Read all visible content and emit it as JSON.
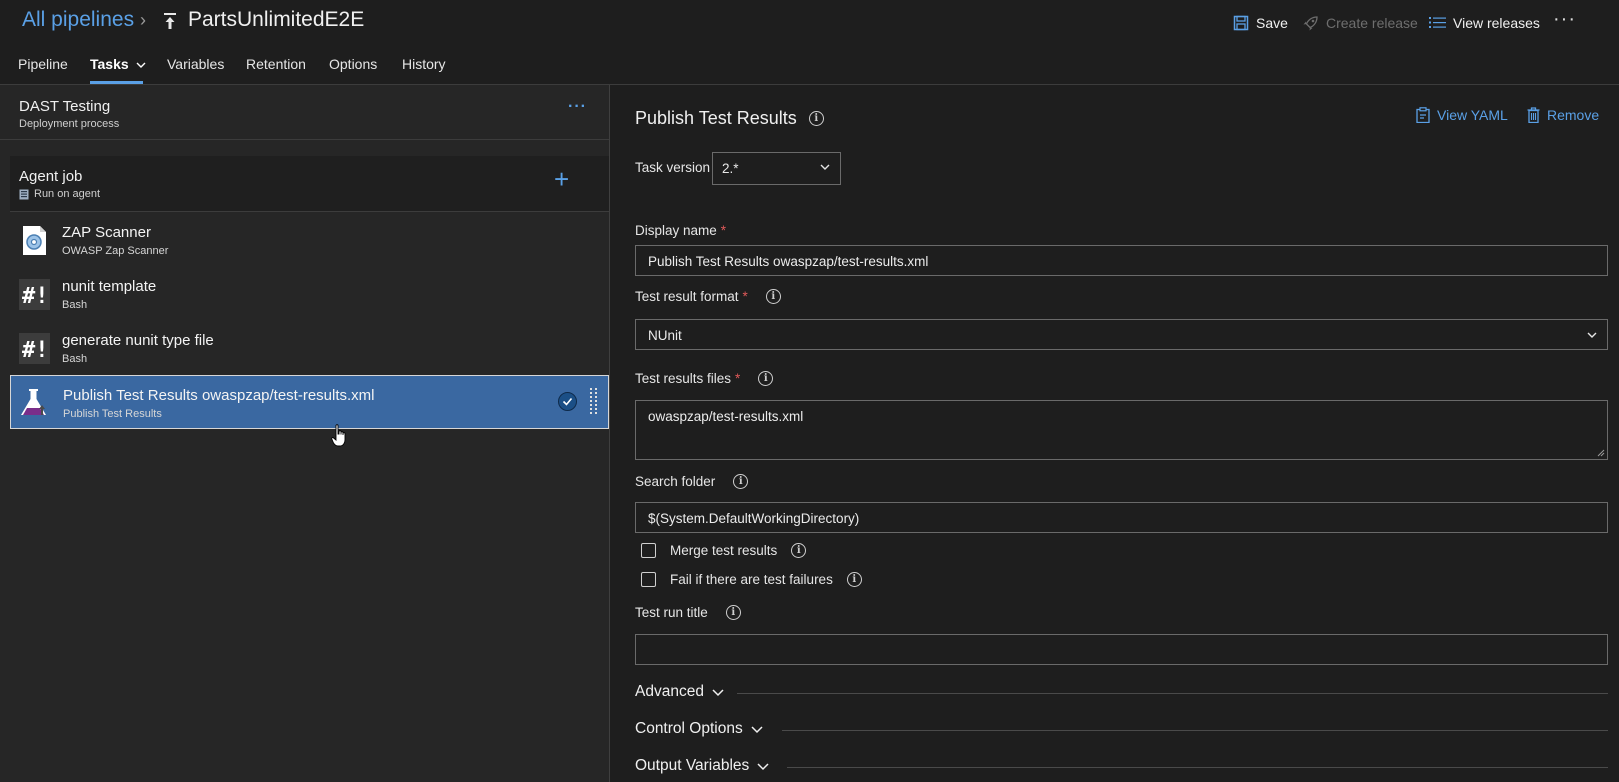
{
  "header": {
    "breadcrumb_root": "All pipelines",
    "pipeline_name": "PartsUnlimitedE2E",
    "actions": {
      "save": "Save",
      "create_release": "Create release",
      "view_releases": "View releases",
      "more": "···"
    }
  },
  "tabs": [
    {
      "label": "Pipeline"
    },
    {
      "label": "Tasks"
    },
    {
      "label": "Variables"
    },
    {
      "label": "Retention"
    },
    {
      "label": "Options"
    },
    {
      "label": "History"
    }
  ],
  "stage": {
    "title": "DAST Testing",
    "subtitle": "Deployment process",
    "more": "···"
  },
  "agent_job": {
    "title": "Agent job",
    "subtitle": "Run on agent",
    "add": "+"
  },
  "tasks": [
    {
      "title": "ZAP Scanner",
      "subtitle": "OWASP Zap Scanner",
      "icon": "zap-scanner-icon"
    },
    {
      "title": "nunit template",
      "subtitle": "Bash",
      "icon": "bash-icon"
    },
    {
      "title": "generate nunit type file",
      "subtitle": "Bash",
      "icon": "bash-icon"
    },
    {
      "title": "Publish Test Results owaspzap/test-results.xml",
      "subtitle": "Publish Test Results",
      "icon": "flask-icon"
    }
  ],
  "detail": {
    "title": "Publish Test Results",
    "view_yaml": "View YAML",
    "remove": "Remove",
    "task_version_label": "Task version",
    "task_version_value": "2.*",
    "display_name_label": "Display name",
    "display_name_value": "Publish Test Results owaspzap/test-results.xml",
    "format_label": "Test result format",
    "format_value": "NUnit",
    "files_label": "Test results files",
    "files_value": "owaspzap/test-results.xml",
    "search_folder_label": "Search folder",
    "search_folder_value": "$(System.DefaultWorkingDirectory)",
    "merge_label": "Merge test results",
    "fail_label": "Fail if there are test failures",
    "run_title_label": "Test run title",
    "run_title_value": "",
    "required_mark": "*",
    "info_glyph": "i"
  },
  "sections": [
    {
      "label": "Advanced"
    },
    {
      "label": "Control Options"
    },
    {
      "label": "Output Variables"
    }
  ],
  "colors": {
    "accent": "#5aa0e6",
    "selected_row": "#3a68a1",
    "required": "#e05a5a"
  }
}
